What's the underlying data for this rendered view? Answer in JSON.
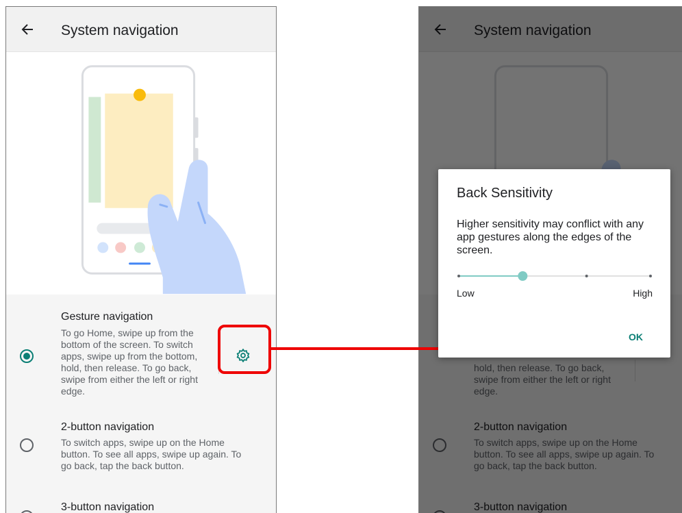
{
  "screen_title": "System navigation",
  "options": [
    {
      "title": "Gesture navigation",
      "desc": [
        "To go Home, swipe up from the",
        "bottom of the screen. To switch",
        "apps, swipe up from the bottom,",
        "hold, then release. To go back,",
        "swipe from either the left or right",
        "edge."
      ],
      "selected": true
    },
    {
      "title": "2-button navigation",
      "desc": [
        "To switch apps, swipe up on the Home",
        "button. To see all apps, swipe up again. To",
        "go back, tap the back button."
      ],
      "selected": false
    },
    {
      "title": "3-button navigation",
      "desc": [],
      "selected": false
    }
  ],
  "dialog": {
    "title": "Back Sensitivity",
    "message": "Higher sensitivity may conflict with any app gestures along the edges of the screen.",
    "slider_min_label": "Low",
    "slider_max_label": "High",
    "slider_steps": 4,
    "slider_level": 2,
    "ok_label": "OK"
  },
  "colors": {
    "accent": "#0b7f75",
    "highlight": "#ee0000",
    "appbar": "#f1f1f1"
  },
  "icons": {
    "back": "arrow-left-icon",
    "settings": "gear-icon"
  }
}
